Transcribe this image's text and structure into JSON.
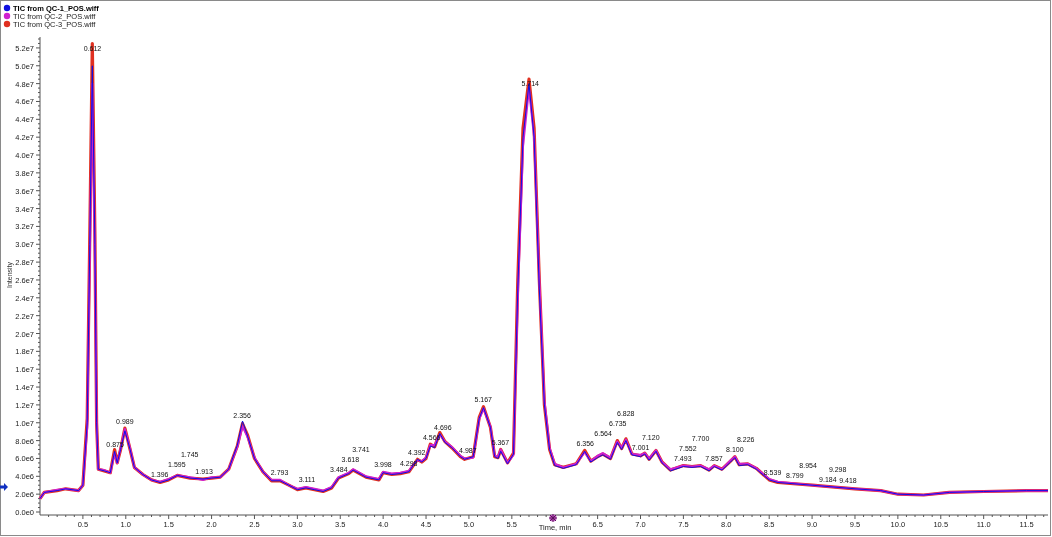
{
  "chart": {
    "chart_data": {
      "type": "line",
      "xlabel": "Time, min",
      "ylabel": "Intensity",
      "legend": "top-left",
      "xlim": [
        0,
        11.75
      ],
      "ylim": [
        0,
        53000000.0
      ],
      "xticks": [
        {
          "value": 0.5,
          "label": "0.5"
        },
        {
          "value": 1,
          "label": "1.0"
        },
        {
          "value": 1.5,
          "label": "1.5"
        },
        {
          "value": 2,
          "label": "2.0"
        },
        {
          "value": 2.5,
          "label": "2.5"
        },
        {
          "value": 3,
          "label": "3.0"
        },
        {
          "value": 3.5,
          "label": "3.5"
        },
        {
          "value": 4,
          "label": "4.0"
        },
        {
          "value": 4.5,
          "label": "4.5"
        },
        {
          "value": 5,
          "label": "5.0"
        },
        {
          "value": 5.5,
          "label": "5.5"
        },
        {
          "value": 6.5,
          "label": "6.5"
        },
        {
          "value": 7,
          "label": "7.0"
        },
        {
          "value": 7.5,
          "label": "7.5"
        },
        {
          "value": 8,
          "label": "8.0"
        },
        {
          "value": 8.5,
          "label": "8.5"
        },
        {
          "value": 9,
          "label": "9.0"
        },
        {
          "value": 9.5,
          "label": "9.5"
        },
        {
          "value": 10,
          "label": "10.0"
        },
        {
          "value": 10.5,
          "label": "10.5"
        },
        {
          "value": 11,
          "label": "11.0"
        },
        {
          "value": 11.5,
          "label": "11.5"
        }
      ],
      "yticks": [
        {
          "value": 0,
          "label": "0.0e0"
        },
        {
          "value": 2000000.0,
          "label": "2.0e6"
        },
        {
          "value": 4000000.0,
          "label": "4.0e6"
        },
        {
          "value": 6000000.0,
          "label": "6.0e6"
        },
        {
          "value": 8000000.0,
          "label": "8.0e6"
        },
        {
          "value": 10000000.0,
          "label": "1.0e7"
        },
        {
          "value": 12000000.0,
          "label": "1.2e7"
        },
        {
          "value": 14000000.0,
          "label": "1.4e7"
        },
        {
          "value": 16000000.0,
          "label": "1.6e7"
        },
        {
          "value": 18000000.0,
          "label": "1.8e7"
        },
        {
          "value": 20000000.0,
          "label": "2.0e7"
        },
        {
          "value": 22000000.0,
          "label": "2.2e7"
        },
        {
          "value": 24000000.0,
          "label": "2.4e7"
        },
        {
          "value": 26000000.0,
          "label": "2.6e7"
        },
        {
          "value": 28000000.0,
          "label": "2.8e7"
        },
        {
          "value": 30000000.0,
          "label": "3.0e7"
        },
        {
          "value": 32000000.0,
          "label": "3.2e7"
        },
        {
          "value": 34000000.0,
          "label": "3.4e7"
        },
        {
          "value": 36000000.0,
          "label": "3.6e7"
        },
        {
          "value": 38000000.0,
          "label": "3.8e7"
        },
        {
          "value": 40000000.0,
          "label": "4.0e7"
        },
        {
          "value": 42000000.0,
          "label": "4.2e7"
        },
        {
          "value": 44000000.0,
          "label": "4.4e7"
        },
        {
          "value": 46000000.0,
          "label": "4.6e7"
        },
        {
          "value": 48000000.0,
          "label": "4.8e7"
        },
        {
          "value": 50000000.0,
          "label": "5.0e7"
        },
        {
          "value": 52000000.0,
          "label": "5.2e7"
        }
      ],
      "x": [
        0,
        0.05,
        0.2,
        0.3,
        0.45,
        0.5,
        0.55,
        0.58,
        0.61,
        0.64,
        0.66,
        0.68,
        0.75,
        0.82,
        0.87,
        0.9,
        0.94,
        0.99,
        1.05,
        1.1,
        1.2,
        1.3,
        1.4,
        1.5,
        1.6,
        1.75,
        1.9,
        2.0,
        2.1,
        2.2,
        2.3,
        2.36,
        2.42,
        2.5,
        2.6,
        2.7,
        2.8,
        2.9,
        3.0,
        3.1,
        3.2,
        3.3,
        3.4,
        3.48,
        3.6,
        3.65,
        3.8,
        3.95,
        4.0,
        4.1,
        4.2,
        4.3,
        4.35,
        4.4,
        4.45,
        4.5,
        4.55,
        4.6,
        4.66,
        4.72,
        4.8,
        4.9,
        4.95,
        5.05,
        5.12,
        5.17,
        5.25,
        5.3,
        5.34,
        5.37,
        5.45,
        5.52,
        5.57,
        5.63,
        5.7,
        5.76,
        5.82,
        5.88,
        5.94,
        6.0,
        6.1,
        6.25,
        6.35,
        6.42,
        6.5,
        6.56,
        6.65,
        6.73,
        6.78,
        6.83,
        6.9,
        7.0,
        7.05,
        7.1,
        7.18,
        7.25,
        7.35,
        7.5,
        7.6,
        7.7,
        7.8,
        7.86,
        7.95,
        8.05,
        8.1,
        8.15,
        8.25,
        8.35,
        8.5,
        8.6,
        9.0,
        9.5,
        9.8,
        10.0,
        10.3,
        10.6,
        11.0,
        11.5,
        11.75
      ],
      "series": [
        {
          "name": "TIC from QC-1_POS.wiff",
          "color": "#1010e0",
          "values": [
            1500000.0,
            2200000.0,
            2400000.0,
            2600000.0,
            2400000.0,
            3000000.0,
            10000000.0,
            30000000.0,
            50000000.0,
            30000000.0,
            10000000.0,
            4800000.0,
            4600000.0,
            4400000.0,
            6800000.0,
            5500000.0,
            7000000.0,
            9100000.0,
            7000000.0,
            5000000.0,
            4200000.0,
            3600000.0,
            3300000.0,
            3600000.0,
            4100000.0,
            3800000.0,
            3700000.0,
            3800000.0,
            3900000.0,
            4800000.0,
            7500000.0,
            10200000.0,
            8500000.0,
            6000000.0,
            4500000.0,
            3500000.0,
            3500000.0,
            3000000.0,
            2500000.0,
            2700000.0,
            2500000.0,
            2300000.0,
            2700000.0,
            3800000.0,
            4300000.0,
            4700000.0,
            3900000.0,
            3600000.0,
            4400000.0,
            4200000.0,
            4300000.0,
            4500000.0,
            5200000.0,
            5900000.0,
            5600000.0,
            6000000.0,
            7400000.0,
            7200000.0,
            8800000.0,
            7800000.0,
            7200000.0,
            6200000.0,
            5900000.0,
            6200000.0,
            10500000.0,
            11700000.0,
            9500000.0,
            6200000.0,
            6000000.0,
            6800000.0,
            5400000.0,
            6500000.0,
            25000000.0,
            42000000.0,
            48000000.0,
            42000000.0,
            25000000.0,
            12000000.0,
            7000000.0,
            5200000.0,
            4900000.0,
            5300000.0,
            6800000.0,
            5600000.0,
            6100000.0,
            6400000.0,
            5900000.0,
            7800000.0,
            7000000.0,
            8000000.0,
            6400000.0,
            6200000.0,
            6500000.0,
            5800000.0,
            6800000.0,
            5500000.0,
            4600000.0,
            5100000.0,
            5000000.0,
            5100000.0,
            4600000.0,
            5100000.0,
            4700000.0,
            5600000.0,
            6100000.0,
            5200000.0,
            5300000.0,
            4800000.0,
            3600000.0,
            3300000.0,
            3000000.0,
            2600000.0,
            2400000.0,
            2000000.0,
            1900000.0,
            2200000.0,
            2300000.0,
            2400000.0,
            2400000.0
          ]
        },
        {
          "name": "TIC from QC-2_POS.wiff",
          "color": "#d020d0",
          "values": [
            1500000.0,
            2200000.0,
            2500000.0,
            2600000.0,
            2400000.0,
            3000000.0,
            9500000.0,
            29000000.0,
            48000000.0,
            29000000.0,
            10000000.0,
            4800000.0,
            4700000.0,
            4400000.0,
            6600000.0,
            5500000.0,
            7100000.0,
            9300000.0,
            7100000.0,
            5000000.0,
            4200000.0,
            3600000.0,
            3400000.0,
            3700000.0,
            4100000.0,
            3900000.0,
            3600000.0,
            3900000.0,
            3900000.0,
            4800000.0,
            7300000.0,
            9600000.0,
            8400000.0,
            6100000.0,
            4500000.0,
            3600000.0,
            3600000.0,
            3000000.0,
            2600000.0,
            2800000.0,
            2600000.0,
            2400000.0,
            2800000.0,
            3900000.0,
            4400000.0,
            4800000.0,
            4000000.0,
            3700000.0,
            4500000.0,
            4300000.0,
            4400000.0,
            4600000.0,
            5300000.0,
            5800000.0,
            5700000.0,
            6100000.0,
            7500000.0,
            7500000.0,
            8700000.0,
            7900000.0,
            7300000.0,
            6300000.0,
            6000000.0,
            6100000.0,
            10400000.0,
            11600000.0,
            9600000.0,
            6300000.0,
            6200000.0,
            7000000.0,
            5500000.0,
            6400000.0,
            24000000.0,
            41000000.0,
            47500000.0,
            42000000.0,
            26000000.0,
            12500000.0,
            7200000.0,
            5400000.0,
            5000000.0,
            5400000.0,
            6700000.0,
            5700000.0,
            6300000.0,
            6600000.0,
            6100000.0,
            7900000.0,
            7200000.0,
            8100000.0,
            6500000.0,
            6400000.0,
            6600000.0,
            6000000.0,
            6900000.0,
            5600000.0,
            4800000.0,
            5200000.0,
            5100000.0,
            5200000.0,
            4800000.0,
            5200000.0,
            4800000.0,
            5800000.0,
            6200000.0,
            5400000.0,
            5400000.0,
            4900000.0,
            3700000.0,
            3400000.0,
            3000000.0,
            2600000.0,
            2400000.0,
            2000000.0,
            1900000.0,
            2200000.0,
            2300000.0,
            2400000.0,
            2400000.0
          ]
        },
        {
          "name": "TIC from QC-3_POS.wiff",
          "color": "#e03020",
          "values": [
            1500000.0,
            2200000.0,
            2400000.0,
            2600000.0,
            2400000.0,
            3000000.0,
            10500000.0,
            31000000.0,
            52500000.0,
            31000000.0,
            10000000.0,
            4800000.0,
            4600000.0,
            4400000.0,
            7000000.0,
            5500000.0,
            7000000.0,
            9400000.0,
            7000000.0,
            5000000.0,
            4200000.0,
            3600000.0,
            3300000.0,
            3600000.0,
            4100000.0,
            3800000.0,
            3700000.0,
            3800000.0,
            3900000.0,
            4800000.0,
            7400000.0,
            9900000.0,
            8600000.0,
            6000000.0,
            4500000.0,
            3500000.0,
            3500000.0,
            3000000.0,
            2500000.0,
            2700000.0,
            2500000.0,
            2300000.0,
            2700000.0,
            3800000.0,
            4300000.0,
            4700000.0,
            3900000.0,
            3600000.0,
            4400000.0,
            4200000.0,
            4300000.0,
            4500000.0,
            5200000.0,
            5900000.0,
            5600000.0,
            6000000.0,
            7600000.0,
            7300000.0,
            8900000.0,
            7900000.0,
            7200000.0,
            6200000.0,
            5900000.0,
            6200000.0,
            10600000.0,
            11800000.0,
            9500000.0,
            6200000.0,
            6100000.0,
            7000000.0,
            5500000.0,
            6600000.0,
            26000000.0,
            43000000.0,
            48500000.0,
            43000000.0,
            26000000.0,
            12000000.0,
            7000000.0,
            5300000.0,
            5000000.0,
            5400000.0,
            6900000.0,
            5700000.0,
            6200000.0,
            6500000.0,
            6000000.0,
            8000000.0,
            7100000.0,
            8200000.0,
            6500000.0,
            6300000.0,
            6600000.0,
            5900000.0,
            6900000.0,
            5600000.0,
            4700000.0,
            5200000.0,
            5100000.0,
            5200000.0,
            4700000.0,
            5200000.0,
            4800000.0,
            5700000.0,
            6200000.0,
            5300000.0,
            5400000.0,
            4900000.0,
            3600000.0,
            3300000.0,
            3000000.0,
            2600000.0,
            2400000.0,
            2000000.0,
            1900000.0,
            2200000.0,
            2300000.0,
            2400000.0,
            2400000.0
          ]
        }
      ],
      "annotations": [
        "0.612",
        "0.875",
        "0.989",
        "1.396",
        "1.595",
        "1.745",
        "1.913",
        "2.356",
        "2.793",
        "3.111",
        "3.484",
        "3.618",
        "3.741",
        "3.998",
        "4.298",
        "4.392",
        "4.566",
        "4.696",
        "4.987",
        "5.167",
        "5.367",
        "5.714",
        "6.356",
        "6.564",
        "6.735",
        "6.828",
        "7.001",
        "7.120",
        "7.493",
        "7.552",
        "7.700",
        "7.857",
        "8.100",
        "8.226",
        "8.539",
        "8.799",
        "8.954",
        "9.184",
        "9.298",
        "9.418"
      ]
    }
  }
}
